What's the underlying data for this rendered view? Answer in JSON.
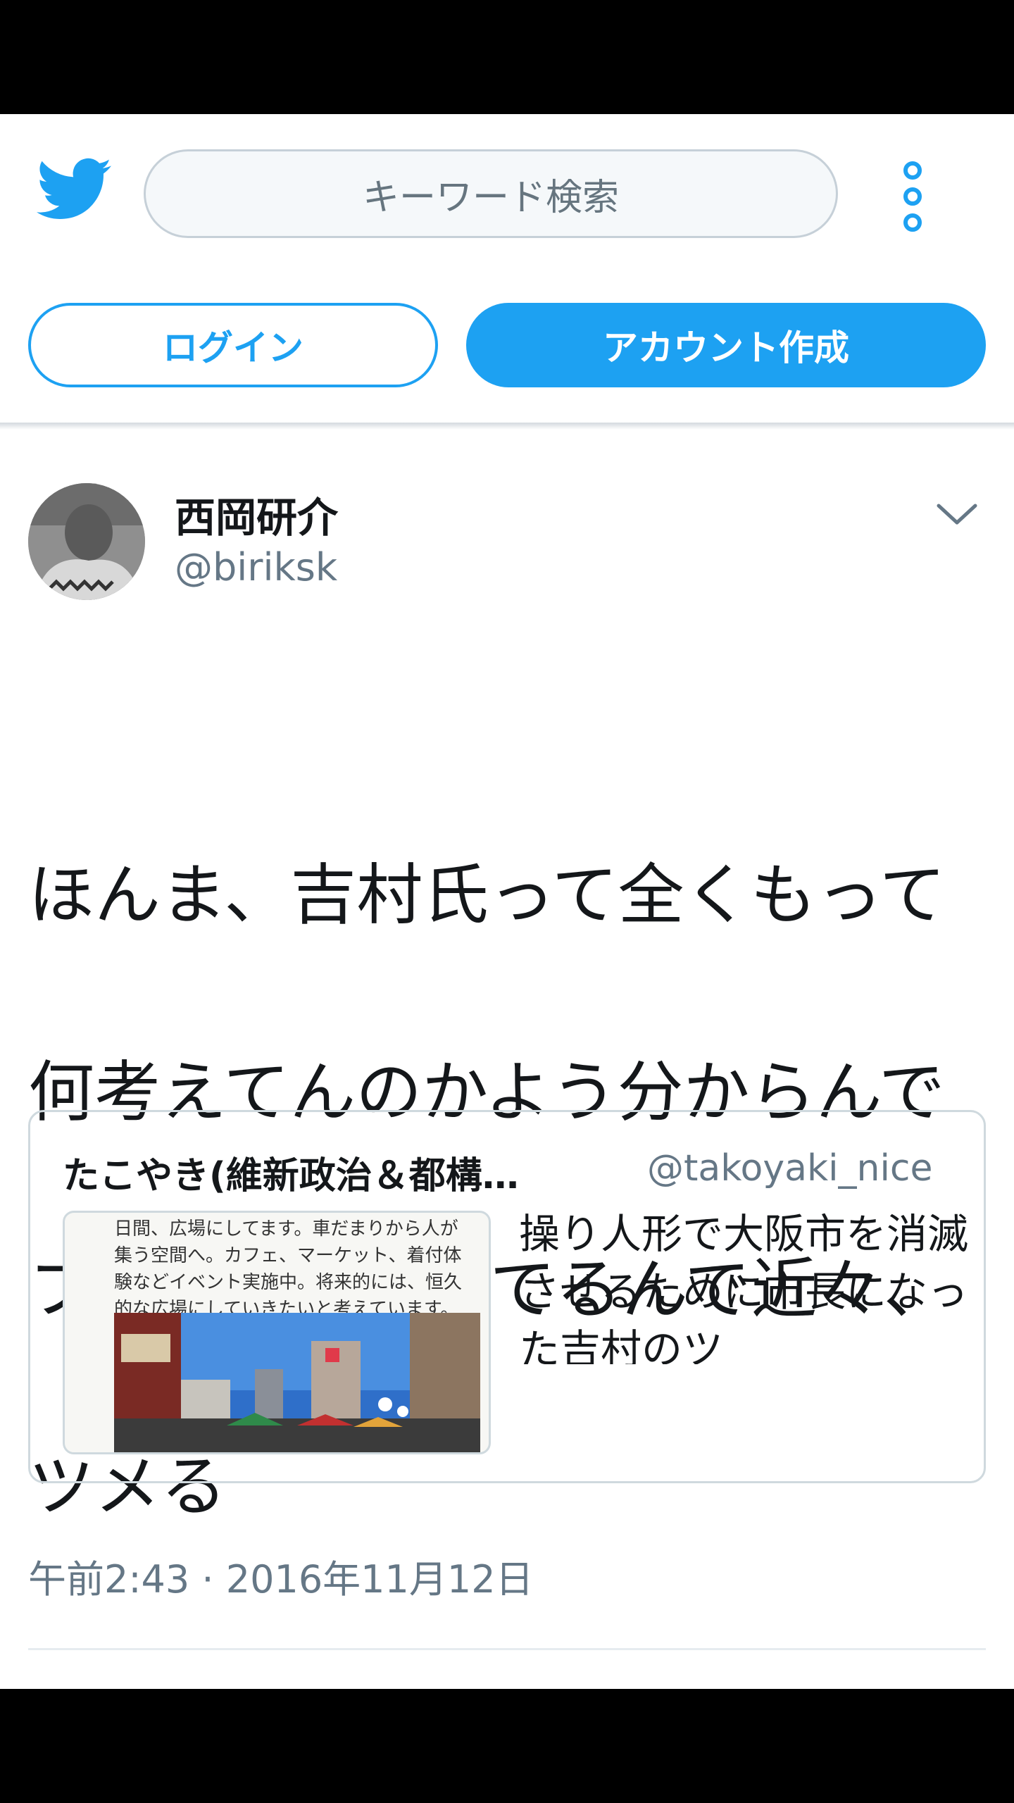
{
  "header": {
    "search_placeholder": "キーワード検索",
    "login_label": "ログイン",
    "signup_label": "アカウント作成",
    "logo_icon": "twitter-bird-icon",
    "menu_icon": "more-vertical-icon"
  },
  "tweet": {
    "author_name": "西岡研介",
    "author_handle": "@biriksk",
    "text_lines": [
      "ほんま、吉村氏って全くもって",
      "何考えてんのかよう分からんで",
      "フニャフニャしてるんで近々、",
      "ツメる"
    ],
    "timestamp": "午前2:43 · 2016年11月12日"
  },
  "quoted_tweet": {
    "author_name": "たこやき(維新政治＆都構…",
    "author_handle": "@takoyaki_nice",
    "text": "操り人形で大阪市を消滅させるために市長になった吉村のツ",
    "media_caption": "日間、広場にしてます。車だまりから人が\n集う空間へ。カフェ、マーケット、着付体\n験などイベント実施中。将来的には、恒久\n的な広場にしていきたいと考えています。"
  },
  "colors": {
    "accent": "#1da1f2",
    "secondary_text": "#657786",
    "border": "#cfd9de"
  }
}
